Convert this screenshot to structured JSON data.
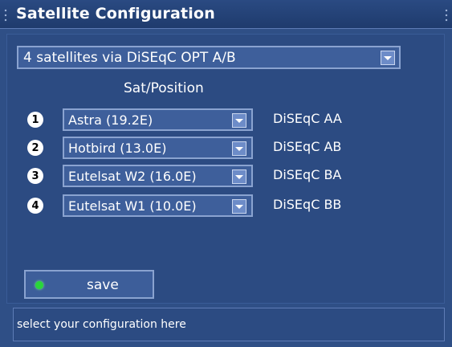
{
  "window": {
    "title": "Satellite Configuration"
  },
  "mode": {
    "selected": "4 satellites via DiSEqC OPT A/B"
  },
  "column_header": "Sat/Position",
  "rows": [
    {
      "num": "1",
      "satellite": "Astra (19.2E)",
      "diseqc": "DiSEqC AA"
    },
    {
      "num": "2",
      "satellite": "Hotbird (13.0E)",
      "diseqc": "DiSEqC AB"
    },
    {
      "num": "3",
      "satellite": "Eutelsat W2 (16.0E)",
      "diseqc": "DiSEqC BA"
    },
    {
      "num": "4",
      "satellite": "Eutelsat W1 (10.0E)",
      "diseqc": "DiSEqC BB"
    }
  ],
  "save": {
    "label": "save",
    "led_color": "#29d63a"
  },
  "status": {
    "text": "select your configuration here"
  },
  "colors": {
    "background": "#2f4f86",
    "field": "#3e5f9b",
    "border": "#8aa3d0"
  }
}
